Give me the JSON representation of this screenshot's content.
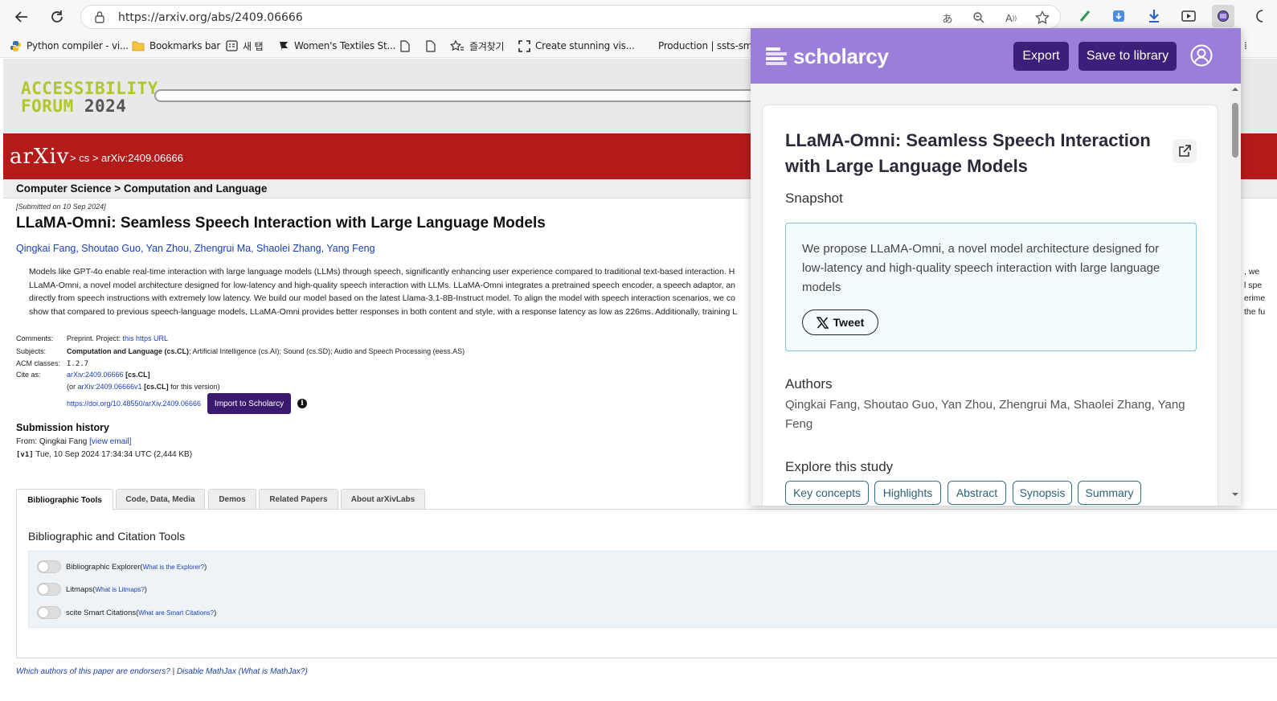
{
  "browser": {
    "url": "https://arxiv.org/abs/2409.06666",
    "bookmarks": [
      {
        "label": "Python compiler - vi..."
      },
      {
        "label": "Bookmarks bar"
      },
      {
        "label": "새 탭"
      },
      {
        "label": "Women's Textiles St..."
      },
      {
        "label": ""
      },
      {
        "label": ""
      },
      {
        "label": "즐겨찾기"
      },
      {
        "label": "Create stunning vis..."
      },
      {
        "label": "Production | ssts-sm..."
      }
    ]
  },
  "banner": {
    "logo_line1": "ACCESSIBILITY",
    "logo_line2": "FORUM",
    "logo_year": "2024"
  },
  "arxiv": {
    "logo": "arXiv",
    "breadcrumb": "> cs > arXiv:2409.06666",
    "subject_bar": "Computer Science > Computation and Language",
    "submitted": "[Submitted on 10 Sep 2024]",
    "title": "LLaMA-Omni: Seamless Speech Interaction with Large Language Models",
    "authors": "Qingkai Fang, Shoutao Guo, Yan Zhou, Zhengrui Ma, Shaolei Zhang, Yang Feng",
    "abstract_lines": [
      "Models like GPT-4o enable real-time interaction with large language models (LLMs) through speech, significantly enhancing user experience compared to traditional text-based interaction. H",
      "LLaMA-Omni, a novel model architecture designed for low-latency and high-quality speech interaction with LLMs. LLaMA-Omni integrates a pretrained speech encoder, a speech adaptor, an",
      "directly from speech instructions with extremely low latency. We build our model based on the latest Llama-3.1-8B-Instruct model. To align the model with speech interaction scenarios, we co",
      "show that compared to previous speech-language models, LLaMA-Omni provides better responses in both content and style, with a response latency as low as 226ms. Additionally, training L"
    ],
    "abstract_right_fragments": [
      ", we",
      "l spe",
      "erime",
      "the fu"
    ],
    "meta": {
      "comments_label": "Comments:",
      "comments_text": "Preprint. Project: ",
      "comments_link": "this https URL",
      "subjects_label": "Subjects:",
      "subjects_bold": "Computation and Language (cs.CL)",
      "subjects_rest": "; Artificial Intelligence (cs.AI); Sound (cs.SD); Audio and Speech Processing (eess.AS)",
      "acm_label": "ACM classes:",
      "acm_value": "I.2.7",
      "cite_label": "Cite as:",
      "cite_link": "arXiv:2409.06666",
      "cite_tag": "[cs.CL]",
      "cite_or": "(or ",
      "cite_v1_link": "arXiv:2409.06666v1",
      "cite_v1_tag": "[cs.CL]",
      "cite_v1_suffix": " for this version)",
      "doi_link": "https://doi.org/10.48550/arXiv.2409.06666",
      "import_button": "Import to Scholarcy"
    },
    "history": {
      "heading": "Submission history",
      "from_text": "From: Qingkai Fang ",
      "view_email": "[view email]",
      "v1_tag": "[v1]",
      "v1_text": " Tue, 10 Sep 2024 17:34:34 UTC (2,444 KB)"
    },
    "tabs": [
      {
        "label": "Bibliographic Tools"
      },
      {
        "label": "Code, Data, Media"
      },
      {
        "label": "Demos"
      },
      {
        "label": "Related Papers"
      },
      {
        "label": "About arXivLabs"
      }
    ],
    "tools_heading": "Bibliographic and Citation Tools",
    "toggles": [
      {
        "label": "Bibliographic Explorer ",
        "link": "What is the Explorer?"
      },
      {
        "label": "Litmaps ",
        "link": "What is Litmaps?"
      },
      {
        "label": "scite Smart Citations ",
        "link": "What are Smart Citations?"
      }
    ],
    "footer": {
      "endorsers": "Which authors of this paper are endorsers?",
      "sep": " | ",
      "disable_mathjax": "Disable MathJax",
      "what_mathjax": " (What is MathJax?)"
    }
  },
  "scholarcy": {
    "brand": "scholarcy",
    "brand_color": "#9b7ed9",
    "button_color": "#3b1f7a",
    "export_label": "Export",
    "save_label": "Save to library",
    "title": "LLaMA-Omni: Seamless Speech Interaction with Large Language Models",
    "snapshot_heading": "Snapshot",
    "snapshot_text": "We propose LLaMA-Omni, a novel model architecture designed for low-latency and high-quality speech interaction with large language models",
    "tweet_label": "Tweet",
    "authors_heading": "Authors",
    "authors_text": "Qingkai Fang, Shoutao Guo, Yan Zhou, Zhengrui Ma, Shaolei Zhang, Yang Feng",
    "explore_heading": "Explore this study",
    "chips": [
      {
        "label": "Key concepts"
      },
      {
        "label": "Highlights"
      },
      {
        "label": "Abstract"
      },
      {
        "label": "Synopsis"
      },
      {
        "label": "Summary"
      }
    ]
  },
  "icons": [
    "back-icon",
    "reload-icon",
    "lock-icon",
    "translate-icon",
    "zoom-icon",
    "read-aloud-icon",
    "star-icon",
    "extension-icons",
    "user-icon",
    "external-link-icon",
    "x-logo-icon",
    "info-icon"
  ]
}
